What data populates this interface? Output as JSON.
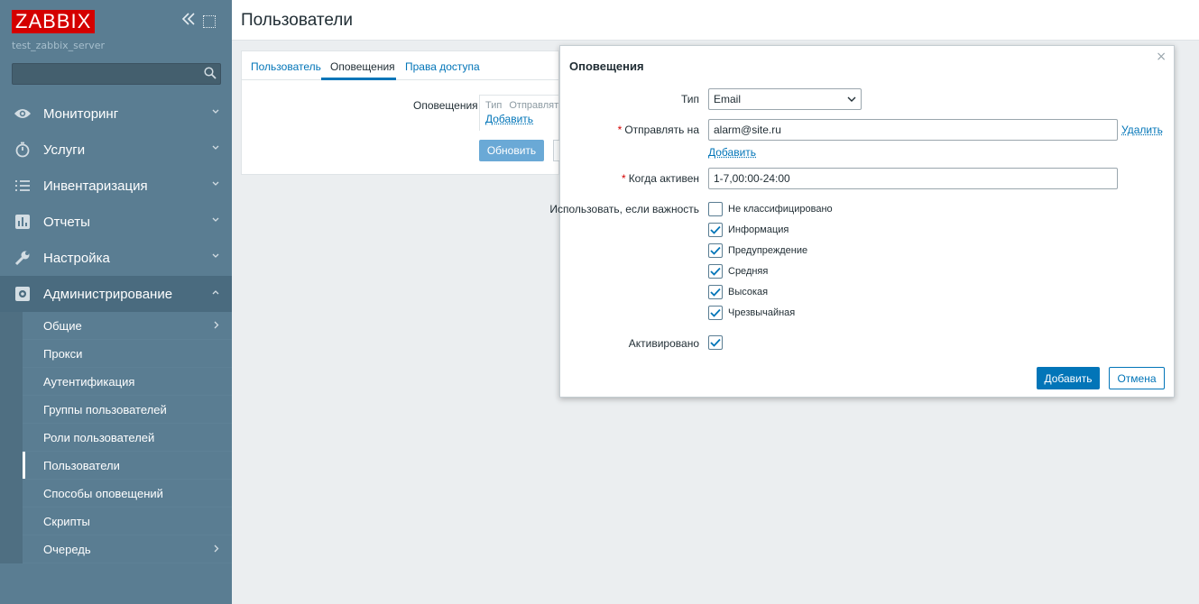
{
  "sidebar": {
    "logo": "ZABBIX",
    "server_name": "test_zabbix_server",
    "search": {
      "placeholder": "",
      "value": ""
    },
    "menu": [
      {
        "label": "Мониторинг",
        "icon": "eye-icon"
      },
      {
        "label": "Услуги",
        "icon": "stopwatch-icon"
      },
      {
        "label": "Инвентаризация",
        "icon": "list-icon"
      },
      {
        "label": "Отчеты",
        "icon": "bar-chart-icon"
      },
      {
        "label": "Настройка",
        "icon": "wrench-icon"
      },
      {
        "label": "Администрирование",
        "icon": "gear-icon"
      }
    ],
    "submenu": [
      {
        "label": "Общие"
      },
      {
        "label": "Прокси"
      },
      {
        "label": "Аутентификация"
      },
      {
        "label": "Группы пользователей"
      },
      {
        "label": "Роли пользователей"
      },
      {
        "label": "Пользователи"
      },
      {
        "label": "Способы оповещений"
      },
      {
        "label": "Скрипты"
      },
      {
        "label": "Очередь"
      }
    ]
  },
  "header": {
    "title": "Пользователи"
  },
  "form": {
    "tabs": [
      {
        "label": "Пользователь"
      },
      {
        "label": "Оповещения"
      },
      {
        "label": "Права доступа"
      }
    ],
    "notifications_label": "Оповещения",
    "table_headers": [
      "Тип",
      "Отправлять"
    ],
    "add_link": "Добавить",
    "update_button": "Обновить"
  },
  "modal": {
    "title": "Оповещения",
    "close": "×",
    "type_label": "Тип",
    "type_value": "Email",
    "send_to_label": "Отправлять на",
    "send_to_value": "alarm@site.ru",
    "remove_link": "Удалить",
    "add_link": "Добавить",
    "when_active_label": "Когда активен",
    "when_active_value": "1-7,00:00-24:00",
    "severity_label": "Использовать, если важность",
    "severities": [
      {
        "label": "Не классифицировано",
        "checked": false
      },
      {
        "label": "Информация",
        "checked": true
      },
      {
        "label": "Предупреждение",
        "checked": true
      },
      {
        "label": "Средняя",
        "checked": true
      },
      {
        "label": "Высокая",
        "checked": true
      },
      {
        "label": "Чрезвычайная",
        "checked": true
      }
    ],
    "enabled_label": "Активировано",
    "enabled": true,
    "add_button": "Добавить",
    "cancel_button": "Отмена"
  },
  "colors": {
    "sidebar_bg": "#5a7d92",
    "accent": "#0275b8",
    "logo_bg": "#d40000"
  }
}
